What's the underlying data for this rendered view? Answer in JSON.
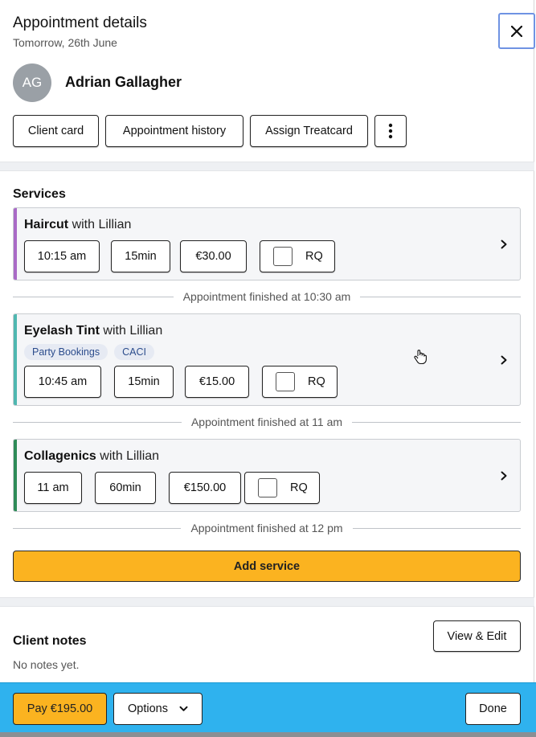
{
  "header": {
    "title": "Appointment details",
    "subtitle": "Tomorrow, 26th June",
    "close_icon": "close-icon"
  },
  "client": {
    "initials": "AG",
    "name": "Adrian Gallagher"
  },
  "actions": {
    "client_card": "Client card",
    "appointment_history": "Appointment history",
    "assign_treatcard": "Assign Treatcard",
    "more_icon": "vertical-ellipsis-icon"
  },
  "services": {
    "title": "Services",
    "items": [
      {
        "name": "Haircut",
        "with": " with Lillian",
        "time": "10:15 am",
        "duration": "15min",
        "price": "€30.00",
        "rq": "RQ",
        "rq_checked": false,
        "color": "#a96ac6",
        "tags": [],
        "finished": "Appointment finished at 10:30 am"
      },
      {
        "name": "Eyelash Tint",
        "with": " with Lillian",
        "time": "10:45 am",
        "duration": "15min",
        "price": "€15.00",
        "rq": "RQ",
        "rq_checked": false,
        "color": "#4fb7b0",
        "tags": [
          "Party Bookings",
          "CACI"
        ],
        "finished": "Appointment finished at 11 am"
      },
      {
        "name": "Collagenics",
        "with": " with Lillian",
        "time": "11 am",
        "duration": "60min",
        "price": "€150.00",
        "rq": "RQ",
        "rq_checked": false,
        "color": "#2e8b57",
        "tags": [],
        "finished": "Appointment finished at 12 pm"
      }
    ],
    "add_label": "Add service"
  },
  "notes": {
    "title": "Client notes",
    "empty": "No notes yet.",
    "view_edit": "View & Edit"
  },
  "footer": {
    "pay": "Pay €195.00",
    "options": "Options",
    "done": "Done"
  },
  "colors": {
    "accent_yellow": "#fbb320",
    "footer_blue": "#2fb2ee",
    "tag_bg": "#e6eaf3",
    "tag_text": "#2b4c8c"
  }
}
